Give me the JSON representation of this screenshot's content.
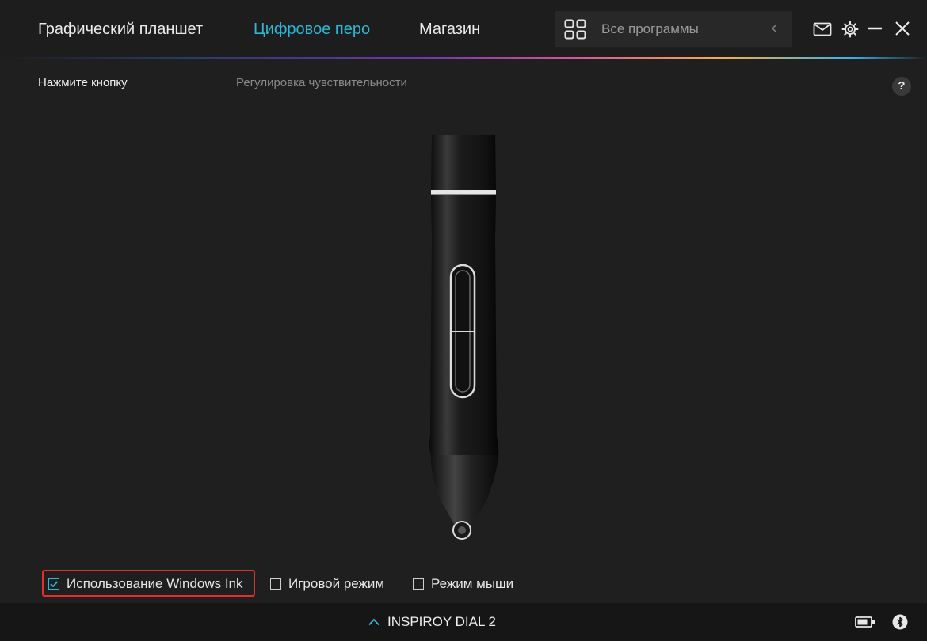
{
  "header": {
    "tabs": [
      {
        "label": "Графический планшет",
        "active": false
      },
      {
        "label": "Цифровое перо",
        "active": true
      },
      {
        "label": "Магазин",
        "active": false
      }
    ],
    "search": {
      "placeholder": "Все программы",
      "icon": "apps-grid-icon"
    },
    "icons": [
      "mail-icon",
      "gear-icon",
      "minimize-icon",
      "close-icon"
    ]
  },
  "subtabs": [
    {
      "label": "Нажмите кнопку",
      "active": true
    },
    {
      "label": "Регулировка чувствительности",
      "active": false
    }
  ],
  "help_label": "?",
  "options": [
    {
      "label": "Использование Windows Ink",
      "checked": true
    },
    {
      "label": "Игровой режим",
      "checked": false
    },
    {
      "label": "Режим мыши",
      "checked": false
    }
  ],
  "footer": {
    "device_name": "INSPIROY DIAL 2",
    "icons": [
      "battery-icon",
      "bluetooth-icon"
    ]
  },
  "colors": {
    "accent": "#2fb6d6",
    "highlight_border": "#e0302a",
    "background": "#1f1f1f"
  }
}
